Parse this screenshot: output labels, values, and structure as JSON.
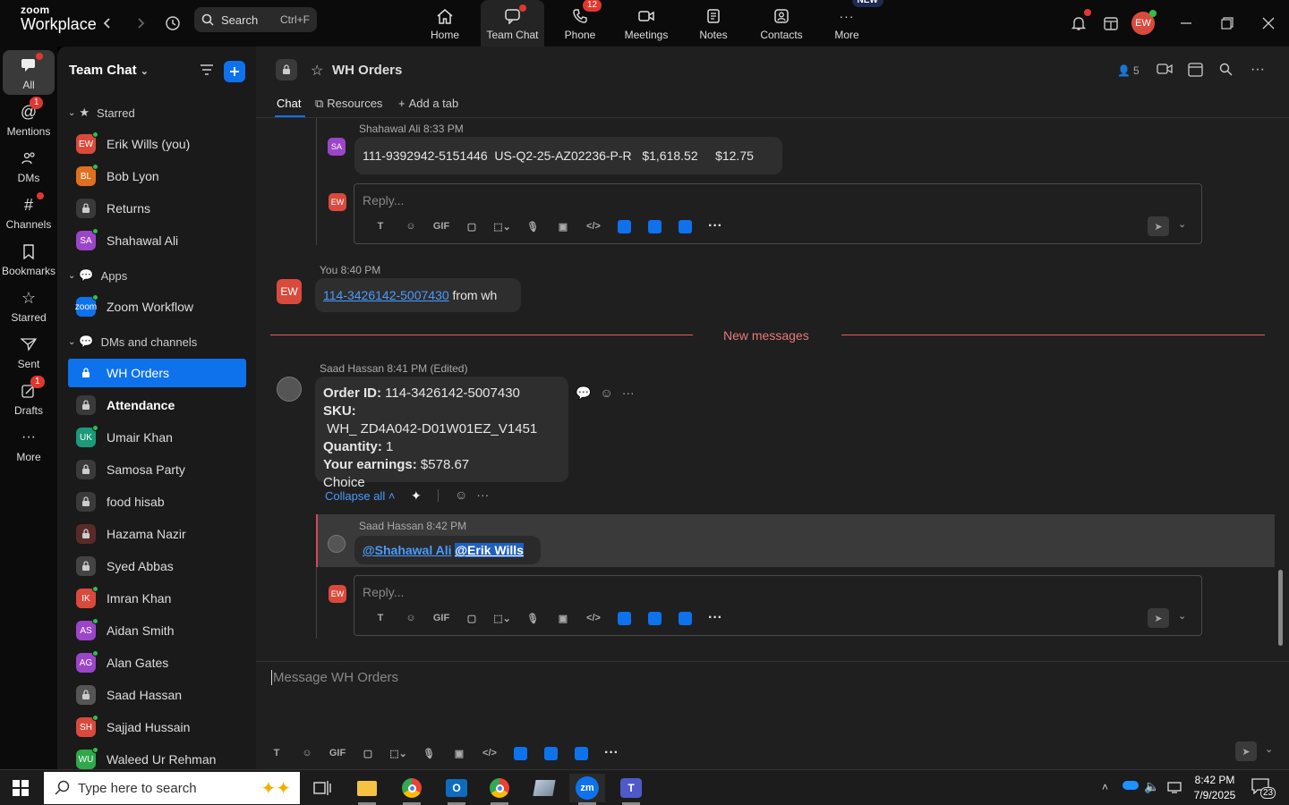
{
  "app": {
    "logo_line1": "zoom",
    "logo_line2": "Workplace"
  },
  "topbar": {
    "search_label": "Search",
    "search_shortcut": "Ctrl+F",
    "nav": [
      {
        "label": "Home",
        "icon": "home-icon"
      },
      {
        "label": "Team Chat",
        "icon": "chat-icon",
        "active": true
      },
      {
        "label": "Phone",
        "icon": "phone-icon",
        "badge": "12"
      },
      {
        "label": "Meetings",
        "icon": "video-icon"
      },
      {
        "label": "Notes",
        "icon": "notes-icon"
      },
      {
        "label": "Contacts",
        "icon": "contacts-icon"
      },
      {
        "label": "More",
        "icon": "more-icon",
        "badge": "NEW"
      }
    ],
    "user_initials": "EW"
  },
  "rail": [
    {
      "label": "All",
      "active": true
    },
    {
      "label": "Mentions",
      "badge": "1"
    },
    {
      "label": "DMs"
    },
    {
      "label": "Channels"
    },
    {
      "label": "Bookmarks"
    },
    {
      "label": "Starred"
    },
    {
      "label": "Sent"
    },
    {
      "label": "Drafts",
      "badge": "1"
    },
    {
      "label": "More"
    }
  ],
  "sidebar": {
    "title": "Team Chat",
    "sections": {
      "starred": "Starred",
      "apps": "Apps",
      "dms": "DMs and channels"
    },
    "starred": [
      {
        "label": "Erik Wills (you)",
        "initials": "EW",
        "color": "#d94a3d"
      },
      {
        "label": "Bob Lyon",
        "initials": "BL",
        "color": "#e07020"
      },
      {
        "label": "Returns",
        "initials": "",
        "color": "#3a3a3a"
      },
      {
        "label": "Shahawal Ali",
        "initials": "SA",
        "color": "#9b45c9"
      }
    ],
    "apps": [
      {
        "label": "Zoom Workflow",
        "initials": "zoom",
        "color": "#0e72ed"
      }
    ],
    "channels": [
      {
        "label": "WH Orders",
        "initials": "",
        "color": "#0e72ed",
        "active": true
      },
      {
        "label": "Attendance",
        "initials": "",
        "color": "#3a3a3a",
        "bold": true
      },
      {
        "label": "Umair Khan",
        "initials": "UK",
        "color": "#1a9b7a"
      },
      {
        "label": "Samosa Party",
        "initials": "",
        "color": "#3a3a3a"
      },
      {
        "label": "food hisab",
        "initials": "",
        "color": "#3a3a3a"
      },
      {
        "label": "Hazama Nazir",
        "initials": "",
        "color": "#5a2a2a"
      },
      {
        "label": "Syed Abbas",
        "initials": "",
        "color": "#444"
      },
      {
        "label": "Imran Khan",
        "initials": "IK",
        "color": "#d94a3d"
      },
      {
        "label": "Aidan Smith",
        "initials": "AS",
        "color": "#9b45c9"
      },
      {
        "label": "Alan Gates",
        "initials": "AG",
        "color": "#9b45c9"
      },
      {
        "label": "Saad Hassan",
        "initials": "",
        "color": "#555"
      },
      {
        "label": "Sajjad Hussain",
        "initials": "SH",
        "color": "#d94a3d"
      },
      {
        "label": "Waleed Ur Rehman",
        "initials": "WU",
        "color": "#2fa84a"
      }
    ]
  },
  "channel": {
    "name": "WH Orders",
    "members": "5",
    "tabs": [
      "Chat",
      "Resources",
      "Add a tab"
    ]
  },
  "messages": {
    "m1": {
      "sender_time": "Shahawal Ali 8:33 PM",
      "initials": "SA",
      "text": "111-9392942-5151446  US-Q2-25-AZ02236-P-R   $1,618.52     $12.75"
    },
    "reply_placeholder": "Reply...",
    "m2": {
      "sender_time": "You 8:40 PM",
      "initials": "EW",
      "link": "114-3426142-5007430",
      "text": " from wh"
    },
    "divider": "New messages",
    "m3": {
      "sender": "Saad Hassan",
      "time": "8:41 PM",
      "edited": "(Edited)",
      "lines": [
        {
          "k": "Order ID:",
          "v": " 114-3426142-5007430"
        },
        {
          "k": "SKU:",
          "v": " WH_ ZD4A042-D01W01EZ_V1451"
        },
        {
          "k": "Quantity:",
          "v": " 1"
        },
        {
          "k": "Your earnings:",
          "v": " $578.67"
        },
        {
          "k": "",
          "v": "Choice"
        }
      ]
    },
    "collapse": "Collapse all",
    "m4": {
      "sender_time": "Saad Hassan 8:42 PM",
      "mention1": "@Shahawal Ali",
      "mention2": "@Erik Wills"
    },
    "composer_placeholder": "Message WH Orders",
    "gif": "GIF"
  },
  "taskbar": {
    "search_placeholder": "Type here to search",
    "time": "8:42 PM",
    "date": "7/9/2025",
    "notif": "23"
  }
}
